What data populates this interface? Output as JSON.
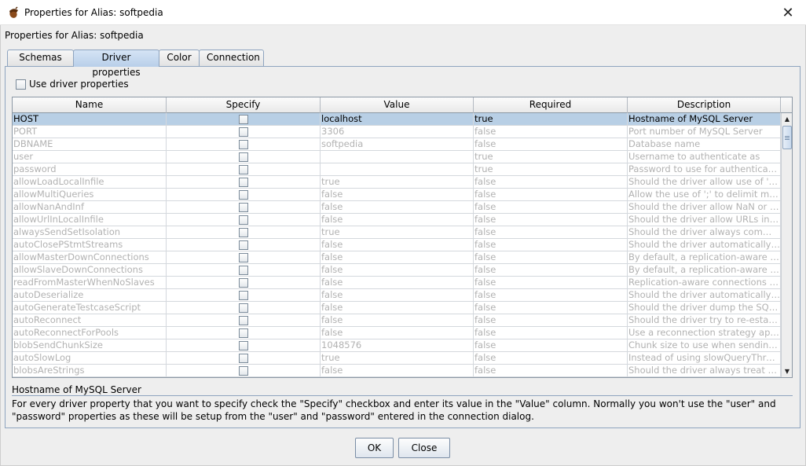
{
  "window": {
    "title": "Properties for Alias: softpedia",
    "icon": "acorn-icon"
  },
  "heading": "Properties for Alias: softpedia",
  "tabs": [
    {
      "label": "Schemas",
      "active": false
    },
    {
      "label": "Driver properties",
      "active": true
    },
    {
      "label": "Color",
      "active": false
    },
    {
      "label": "Connection",
      "active": false
    }
  ],
  "use_driver_properties": {
    "label": "Use driver properties",
    "checked": false
  },
  "table": {
    "columns": [
      "Name",
      "Specify",
      "Value",
      "Required",
      "Description"
    ],
    "rows": [
      {
        "name": "HOST",
        "value": "localhost",
        "required": "true",
        "description": "Hostname of MySQL Server",
        "selected": true
      },
      {
        "name": "PORT",
        "value": "3306",
        "required": "false",
        "description": "Port number of MySQL Server"
      },
      {
        "name": "DBNAME",
        "value": "softpedia",
        "required": "false",
        "description": "Database name"
      },
      {
        "name": "user",
        "value": "",
        "required": "true",
        "description": "Username to authenticate as"
      },
      {
        "name": "password",
        "value": "",
        "required": "true",
        "description": "Password to use for authentication"
      },
      {
        "name": "allowLoadLocalInfile",
        "value": "true",
        "required": "false",
        "description": "Should the driver allow use of 'LO..."
      },
      {
        "name": "allowMultiQueries",
        "value": "false",
        "required": "false",
        "description": "Allow the use of ';' to delimit multi..."
      },
      {
        "name": "allowNanAndInf",
        "value": "false",
        "required": "false",
        "description": "Should the driver allow NaN or +/-..."
      },
      {
        "name": "allowUrlInLocalInfile",
        "value": "false",
        "required": "false",
        "description": "Should the driver allow URLs in '..."
      },
      {
        "name": "alwaysSendSetIsolation",
        "value": "true",
        "required": "false",
        "description": "Should the driver always commu..."
      },
      {
        "name": "autoClosePStmtStreams",
        "value": "false",
        "required": "false",
        "description": "Should the driver automatically ca..."
      },
      {
        "name": "allowMasterDownConnections",
        "value": "false",
        "required": "false",
        "description": "By default, a replication-aware co..."
      },
      {
        "name": "allowSlaveDownConnections",
        "value": "false",
        "required": "false",
        "description": "By default, a replication-aware co..."
      },
      {
        "name": "readFromMasterWhenNoSlaves",
        "value": "false",
        "required": "false",
        "description": "Replication-aware connections di..."
      },
      {
        "name": "autoDeserialize",
        "value": "false",
        "required": "false",
        "description": "Should the driver automatically d..."
      },
      {
        "name": "autoGenerateTestcaseScript",
        "value": "false",
        "required": "false",
        "description": "Should the driver dump the SQL it..."
      },
      {
        "name": "autoReconnect",
        "value": "false",
        "required": "false",
        "description": "Should the driver try to re-establis..."
      },
      {
        "name": "autoReconnectForPools",
        "value": "false",
        "required": "false",
        "description": "Use a reconnection strategy appr..."
      },
      {
        "name": "blobSendChunkSize",
        "value": "1048576",
        "required": "false",
        "description": "Chunk size to use when sending ..."
      },
      {
        "name": "autoSlowLog",
        "value": "true",
        "required": "false",
        "description": "Instead of using slowQueryThres..."
      },
      {
        "name": "blobsAreStrings",
        "value": "false",
        "required": "false",
        "description": "Should the driver always treat BL..."
      }
    ]
  },
  "description": {
    "title": "Hostname of MySQL Server",
    "text": "For every driver property that you want to specify check the \"Specify\" checkbox and enter its value in the \"Value\" column. Normally you won't use the \"user\" and \"password\" properties as these will be setup from the \"user\" and \"password\" entered in the connection dialog."
  },
  "buttons": {
    "ok": "OK",
    "close": "Close"
  },
  "colors": {
    "selection": "#b8cfe5",
    "disabled_text": "#b2b2b2",
    "tab_active": "#c7daf0"
  }
}
